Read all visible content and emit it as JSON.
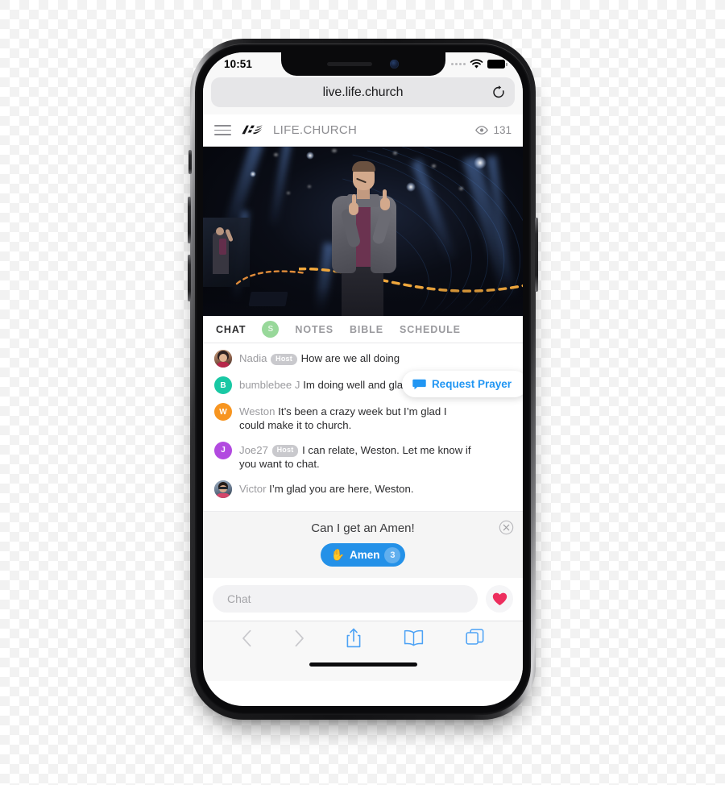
{
  "device": {
    "name": "iphone-x",
    "status_bar": {
      "time": "10:51",
      "wifi_icon": "wifi-icon",
      "battery_icon": "battery-full-icon",
      "signal_icon": "signal-dots-icon"
    }
  },
  "browser": {
    "name": "safari",
    "url": "live.life.church",
    "reload_icon": "reload-icon",
    "toolbar": [
      {
        "name": "back-button",
        "icon": "chevron-left-icon",
        "enabled": false
      },
      {
        "name": "forward-button",
        "icon": "chevron-right-icon",
        "enabled": false
      },
      {
        "name": "share-button",
        "icon": "share-icon",
        "enabled": true
      },
      {
        "name": "bookmarks-button",
        "icon": "book-icon",
        "enabled": true
      },
      {
        "name": "tabs-button",
        "icon": "tabs-icon",
        "enabled": true
      }
    ],
    "accent_color": "#4da2f5"
  },
  "site_header": {
    "menu_icon": "hamburger-icon",
    "logo_icon": "life-church-logo-icon",
    "brand": "LIFE.CHURCH",
    "viewers_icon": "eye-icon",
    "viewers_count": "131"
  },
  "video": {
    "name": "live-stream-player",
    "description": "Pastor speaking on a dark stage with blue stage lights"
  },
  "tabs": {
    "items": [
      {
        "label": "CHAT",
        "active": true
      },
      {
        "label": "NOTES",
        "active": false
      },
      {
        "label": "BIBLE",
        "active": false
      },
      {
        "label": "SCHEDULE",
        "active": false
      }
    ],
    "badge": {
      "label": "S",
      "color": "#98d89a"
    }
  },
  "chat": {
    "messages": [
      {
        "avatar_type": "photo",
        "avatar_initial": "N",
        "avatar_color": "#8a6a5a",
        "name": "Nadia",
        "badge": "Host",
        "text": "How are we all doing"
      },
      {
        "avatar_type": "initial",
        "avatar_initial": "B",
        "avatar_color": "#19c8a4",
        "name": "bumblebee J",
        "badge": "",
        "text": "Im doing well and glad to be here."
      },
      {
        "avatar_type": "initial",
        "avatar_initial": "W",
        "avatar_color": "#f79520",
        "name": "Weston",
        "badge": "",
        "text": "It’s been a crazy week but I’m glad I could make it to church."
      },
      {
        "avatar_type": "initial",
        "avatar_initial": "J",
        "avatar_color": "#b24ae0",
        "name": "Joe27",
        "badge": "Host",
        "text": "I can relate, Weston. Let me know if you want to chat."
      },
      {
        "avatar_type": "photo",
        "avatar_initial": "V",
        "avatar_color": "#5a6a80",
        "name": "Victor",
        "badge": "",
        "text": "I’m glad you are here, Weston."
      }
    ],
    "request_prayer": {
      "label": "Request Prayer",
      "icon": "chat-bubble-icon",
      "color": "#2196f3"
    },
    "input": {
      "placeholder": "Chat",
      "value": ""
    },
    "heart_icon": "heart-icon",
    "heart_color": "#ed2e5e"
  },
  "amen_prompt": {
    "title": "Can I get an Amen!",
    "button_label": "Amen",
    "button_emoji": "✋",
    "count": "3",
    "button_color": "#2491e8",
    "close_icon": "close-circle-icon"
  }
}
